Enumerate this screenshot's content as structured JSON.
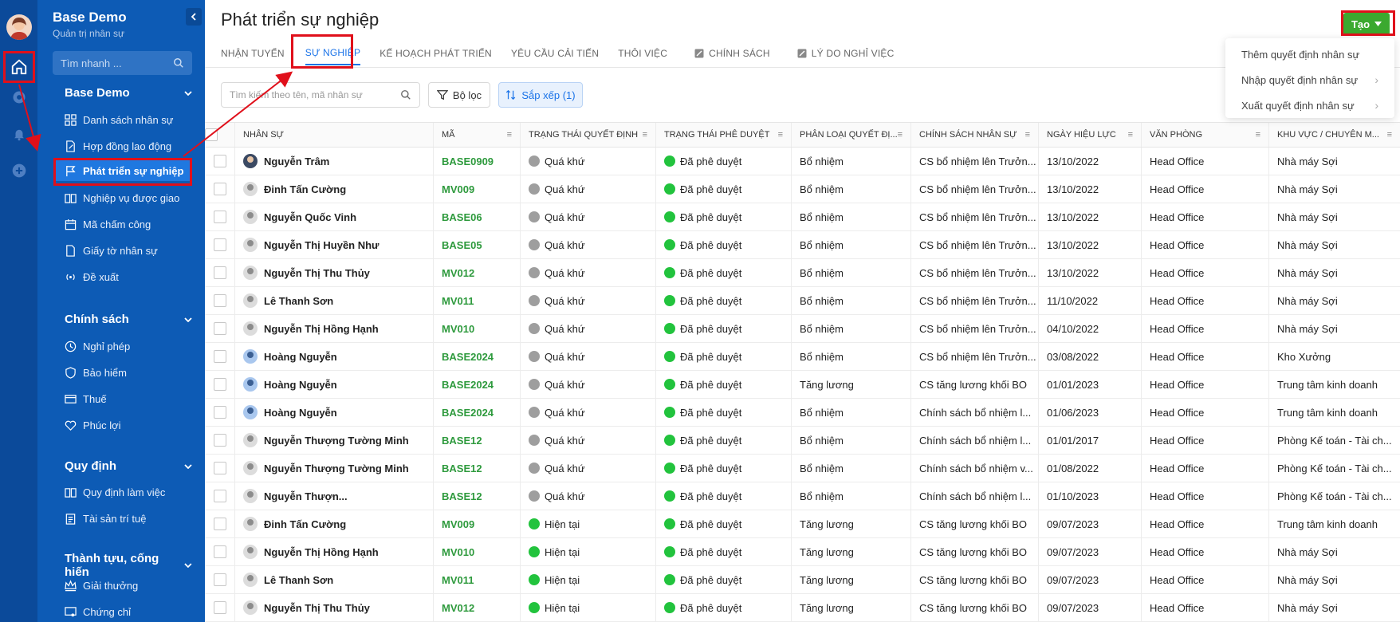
{
  "rail": {
    "icons": [
      "home-icon",
      "gear-icon",
      "bell-icon",
      "plus-circle-icon"
    ]
  },
  "sidebar": {
    "title": "Base Demo",
    "subtitle": "Quản trị nhân sự",
    "search_placeholder": "Tìm nhanh ...",
    "sections": [
      {
        "label": "Base Demo",
        "items": [
          "Danh sách nhân sự",
          "Hợp đồng lao động",
          "Phát triển sự nghiệp",
          "Nghiệp vụ được giao",
          "Mã chấm công",
          "Giấy tờ nhân sự",
          "Đề xuất"
        ]
      },
      {
        "label": "Chính sách",
        "items": [
          "Nghỉ phép",
          "Bảo hiểm",
          "Thuế",
          "Phúc lợi"
        ]
      },
      {
        "label": "Quy định",
        "items": [
          "Quy định làm việc",
          "Tài sản trí tuệ"
        ]
      },
      {
        "label": "Thành tựu, cống hiến",
        "items": [
          "Giải thưởng",
          "Chứng chỉ"
        ]
      }
    ]
  },
  "main": {
    "title": "Phát triển sự nghiệp",
    "tabs": [
      "NHẬN TUYỂN",
      "SỰ NGHIỆP",
      "KẾ HOẠCH PHÁT TRIỂN",
      "YÊU CẦU CẢI TIẾN",
      "THÔI VIỆC",
      "CHÍNH SÁCH",
      "LÝ DO NGHỈ VIỆC"
    ],
    "active_tab": "SỰ NGHIỆP",
    "create_label": "Tạo",
    "dropdown": [
      "Thêm quyết định nhân sự",
      "Nhập quyết định nhân sự",
      "Xuất quyết định nhân sự"
    ],
    "search_placeholder": "Tìm kiếm theo tên, mã nhân sự",
    "filter_label": "Bộ lọc",
    "sort_label": "Sắp xếp (1)"
  },
  "table": {
    "headers": [
      "NHÂN SỰ",
      "MÃ",
      "TRẠNG THÁI QUYẾT ĐỊNH",
      "TRẠNG THÁI PHÊ DUYỆT",
      "PHÂN LOẠI QUYẾT ĐỊ...",
      "CHÍNH SÁCH NHÂN SỰ",
      "NGÀY HIỆU LỰC",
      "VĂN PHÒNG",
      "KHU VỰC / CHUYÊN M..."
    ],
    "rows": [
      {
        "name": "Nguyễn Trâm",
        "avatar": "photo",
        "code": "BASE0909",
        "status": "Quá khứ",
        "status_color": "grey",
        "approval": "Đã phê duyệt",
        "type": "Bổ nhiệm",
        "policy": "CS bổ nhiệm lên Trưởn...",
        "date": "13/10/2022",
        "office": "Head Office",
        "area": "Nhà máy Sợi"
      },
      {
        "name": "Đinh Tấn Cường",
        "avatar": "default",
        "code": "MV009",
        "status": "Quá khứ",
        "status_color": "grey",
        "approval": "Đã phê duyệt",
        "type": "Bổ nhiệm",
        "policy": "CS bổ nhiệm lên Trưởn...",
        "date": "13/10/2022",
        "office": "Head Office",
        "area": "Nhà máy Sợi"
      },
      {
        "name": "Nguyễn Quốc Vinh",
        "avatar": "default",
        "code": "BASE06",
        "status": "Quá khứ",
        "status_color": "grey",
        "approval": "Đã phê duyệt",
        "type": "Bổ nhiệm",
        "policy": "CS bổ nhiệm lên Trưởn...",
        "date": "13/10/2022",
        "office": "Head Office",
        "area": "Nhà máy Sợi"
      },
      {
        "name": "Nguyễn Thị Huyền Như",
        "avatar": "default",
        "code": "BASE05",
        "status": "Quá khứ",
        "status_color": "grey",
        "approval": "Đã phê duyệt",
        "type": "Bổ nhiệm",
        "policy": "CS bổ nhiệm lên Trưởn...",
        "date": "13/10/2022",
        "office": "Head Office",
        "area": "Nhà máy Sợi"
      },
      {
        "name": "Nguyễn Thị Thu Thủy",
        "avatar": "default",
        "code": "MV012",
        "status": "Quá khứ",
        "status_color": "grey",
        "approval": "Đã phê duyệt",
        "type": "Bổ nhiệm",
        "policy": "CS bổ nhiệm lên Trưởn...",
        "date": "13/10/2022",
        "office": "Head Office",
        "area": "Nhà máy Sợi"
      },
      {
        "name": "Lê Thanh Sơn",
        "avatar": "default",
        "code": "MV011",
        "status": "Quá khứ",
        "status_color": "grey",
        "approval": "Đã phê duyệt",
        "type": "Bổ nhiệm",
        "policy": "CS bổ nhiệm lên Trưởn...",
        "date": "11/10/2022",
        "office": "Head Office",
        "area": "Nhà máy Sợi"
      },
      {
        "name": "Nguyễn Thị Hồng Hạnh",
        "avatar": "default",
        "code": "MV010",
        "status": "Quá khứ",
        "status_color": "grey",
        "approval": "Đã phê duyệt",
        "type": "Bổ nhiệm",
        "policy": "CS bổ nhiệm lên Trưởn...",
        "date": "04/10/2022",
        "office": "Head Office",
        "area": "Nhà máy Sợi"
      },
      {
        "name": "Hoàng Nguyễn",
        "avatar": "photo2",
        "code": "BASE2024",
        "status": "Quá khứ",
        "status_color": "grey",
        "approval": "Đã phê duyệt",
        "type": "Bổ nhiệm",
        "policy": "CS bổ nhiệm lên Trưởn...",
        "date": "03/08/2022",
        "office": "Head Office",
        "area": "Kho Xưởng"
      },
      {
        "name": "Hoàng Nguyễn",
        "avatar": "photo2",
        "code": "BASE2024",
        "status": "Quá khứ",
        "status_color": "grey",
        "approval": "Đã phê duyệt",
        "type": "Tăng lương",
        "policy": "CS tăng lương khối BO",
        "date": "01/01/2023",
        "office": "Head Office",
        "area": "Trung tâm kinh doanh"
      },
      {
        "name": "Hoàng Nguyễn",
        "avatar": "photo2",
        "code": "BASE2024",
        "status": "Quá khứ",
        "status_color": "grey",
        "approval": "Đã phê duyệt",
        "type": "Bổ nhiệm",
        "policy": "Chính sách bổ nhiệm l...",
        "date": "01/06/2023",
        "office": "Head Office",
        "area": "Trung tâm kinh doanh"
      },
      {
        "name": "Nguyễn Thượng Tường Minh",
        "avatar": "default",
        "code": "BASE12",
        "status": "Quá khứ",
        "status_color": "grey",
        "approval": "Đã phê duyệt",
        "type": "Bổ nhiệm",
        "policy": "Chính sách bổ nhiệm l...",
        "date": "01/01/2017",
        "office": "Head Office",
        "area": "Phòng Kế toán - Tài ch..."
      },
      {
        "name": "Nguyễn Thượng Tường Minh",
        "avatar": "default",
        "code": "BASE12",
        "status": "Quá khứ",
        "status_color": "grey",
        "approval": "Đã phê duyệt",
        "type": "Bổ nhiệm",
        "policy": "Chính sách bổ nhiệm v...",
        "date": "01/08/2022",
        "office": "Head Office",
        "area": "Phòng Kế toán - Tài ch..."
      },
      {
        "name": "Nguyễn Thượn...",
        "avatar": "default",
        "code": "BASE12",
        "status": "Quá khứ",
        "status_color": "grey",
        "approval": "Đã phê duyệt",
        "type": "Bổ nhiệm",
        "policy": "Chính sách bổ nhiệm l...",
        "date": "01/10/2023",
        "office": "Head Office",
        "area": "Phòng Kế toán - Tài ch..."
      },
      {
        "name": "Đinh Tấn Cường",
        "avatar": "default",
        "code": "MV009",
        "status": "Hiện tại",
        "status_color": "green",
        "approval": "Đã phê duyệt",
        "type": "Tăng lương",
        "policy": "CS tăng lương khối BO",
        "date": "09/07/2023",
        "office": "Head Office",
        "area": "Trung tâm kinh doanh"
      },
      {
        "name": "Nguyễn Thị Hồng Hạnh",
        "avatar": "default",
        "code": "MV010",
        "status": "Hiện tại",
        "status_color": "green",
        "approval": "Đã phê duyệt",
        "type": "Tăng lương",
        "policy": "CS tăng lương khối BO",
        "date": "09/07/2023",
        "office": "Head Office",
        "area": "Nhà máy Sợi"
      },
      {
        "name": "Lê Thanh Sơn",
        "avatar": "default",
        "code": "MV011",
        "status": "Hiện tại",
        "status_color": "green",
        "approval": "Đã phê duyệt",
        "type": "Tăng lương",
        "policy": "CS tăng lương khối BO",
        "date": "09/07/2023",
        "office": "Head Office",
        "area": "Nhà máy Sợi"
      },
      {
        "name": "Nguyễn Thị Thu Thủy",
        "avatar": "default",
        "code": "MV012",
        "status": "Hiện tại",
        "status_color": "green",
        "approval": "Đã phê duyệt",
        "type": "Tăng lương",
        "policy": "CS tăng lương khối BO",
        "date": "09/07/2023",
        "office": "Head Office",
        "area": "Nhà máy Sợi"
      }
    ]
  }
}
